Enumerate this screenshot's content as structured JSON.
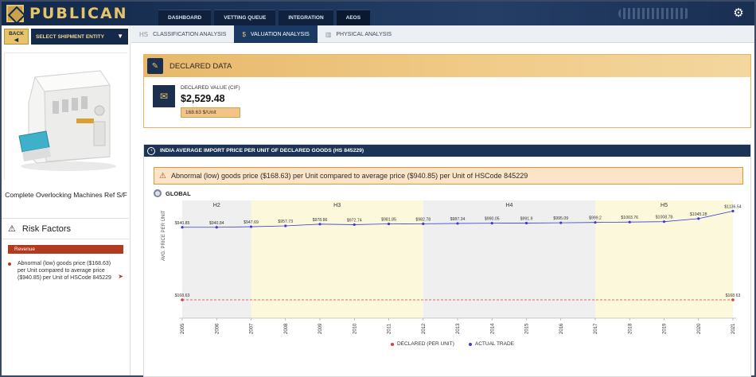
{
  "app": {
    "name": "PUBLICAN",
    "top_tabs": [
      "DASHBOARD",
      "VETTING QUEUE",
      "INTEGRATION",
      "AEOS"
    ]
  },
  "left": {
    "back_label": "BACK",
    "entity_select": "SELECT SHIPMENT ENTITY",
    "product_name": "Complete Overlocking Machines Ref S/F",
    "risk_title": "Risk Factors",
    "risk_badge": "Revenue",
    "risk_item": "Abnormal (low) goods price ($168.63) per Unit compared to average price ($940.85) per Unit of HSCode 845229"
  },
  "tabs": [
    {
      "label": "CLASSIFICATION ANALYSIS",
      "icon": "hs-icon",
      "glyph": "HS"
    },
    {
      "label": "VALUATION ANALYSIS",
      "icon": "money-bag-icon",
      "glyph": "$"
    },
    {
      "label": "PHYSICAL ANALYSIS",
      "icon": "barcode-icon",
      "glyph": "▥"
    }
  ],
  "declared": {
    "title": "DECLARED DATA",
    "value_label": "DECLARED VALUE (CIF)",
    "value": "$2,529.48",
    "unit_price": "168.63 $/Unit"
  },
  "price_panel": {
    "title": "INDIA AVERAGE IMPORT PRICE PER UNIT OF DECLARED GOODS (HS 845229)",
    "alert": "Abnormal (low) goods price ($168.63) per Unit compared to average price ($940.85) per Unit of HSCode 845229",
    "global_label": "GLOBAL"
  },
  "colors": {
    "navy": "#1b3355",
    "gold": "#e5c56a",
    "declared_series": "#e53935",
    "actual_series": "#3b3bd6",
    "band_grey": "#efefef",
    "band_yellow": "#fcf8dc"
  },
  "chart_data": {
    "type": "line",
    "title": "",
    "ylabel": "AVG. PRICE PER UNIT",
    "xlabel": "",
    "x": [
      "2005",
      "2006",
      "2007",
      "2008",
      "2009",
      "2010",
      "2011",
      "2012",
      "2013",
      "2014",
      "2015",
      "2016",
      "2017",
      "2018",
      "2019",
      "2020",
      "2021"
    ],
    "bands": [
      {
        "label": "H2",
        "from": "2005",
        "to": "2007",
        "color": "grey"
      },
      {
        "label": "H3",
        "from": "2007",
        "to": "2012",
        "color": "yellow"
      },
      {
        "label": "H4",
        "from": "2012",
        "to": "2017",
        "color": "grey"
      },
      {
        "label": "H5",
        "from": "2017",
        "to": "2021",
        "color": "yellow"
      }
    ],
    "series": [
      {
        "name": "DECLARED (PER UNIT)",
        "values": [
          168.63,
          168.63,
          168.63,
          168.63,
          168.63,
          168.63,
          168.63,
          168.63,
          168.63,
          168.63,
          168.63,
          168.63,
          168.63,
          168.63,
          168.63,
          168.63,
          168.63
        ],
        "labels": [
          "$168.63",
          "",
          "",
          "",
          "",
          "",
          "",
          "",
          "",
          "",
          "",
          "",
          "",
          "",
          "",
          "",
          "$168.63"
        ],
        "style": "dashed"
      },
      {
        "name": "ACTUAL TRADE",
        "values": [
          940.85,
          940.84,
          947.69,
          957.73,
          978.86,
          972.74,
          981.85,
          982.78,
          987.34,
          990.05,
          991.9,
          995.09,
          999.2,
          1003.76,
          1008.78,
          1045.28,
          1136.54
        ],
        "labels": [
          "$940.85",
          "$940.84",
          "$947.69",
          "$957.73",
          "$978.86",
          "$972.74",
          "$981.85",
          "$982.78",
          "$987.34",
          "$990.05",
          "$991.9",
          "$995.09",
          "$999.2",
          "$1003.76",
          "$1008.78",
          "$1045.28",
          "$1136.54"
        ],
        "style": "solid"
      }
    ],
    "legend": "bottom-center",
    "grid": false
  }
}
